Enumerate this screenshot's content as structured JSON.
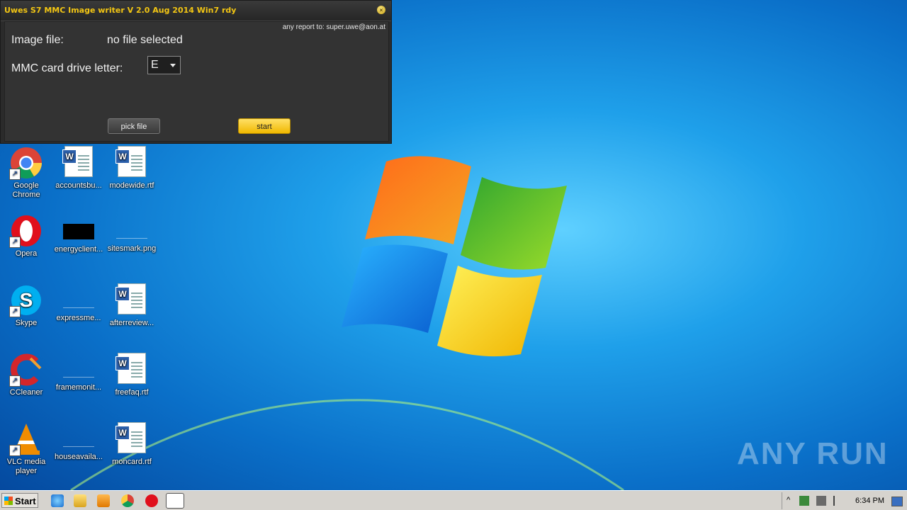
{
  "app": {
    "title": "Uwes S7 MMC Image writer V 2.0  Aug 2014 Win7 rdy",
    "report": "any report to: super.uwe@aon.at",
    "image_file_label": "Image file:",
    "image_file_value": "no file selected",
    "drive_label": "MMC card drive letter:",
    "drive_value": "E",
    "pick_label": "pick file",
    "start_label": "start"
  },
  "desktop": {
    "icons": [
      {
        "label": "Google Chrome",
        "icon": "chrome-icon"
      },
      {
        "label": "accountsbu...",
        "icon": "word-doc-icon"
      },
      {
        "label": "modewide.rtf",
        "icon": "word-doc-icon"
      },
      {
        "label": "Opera",
        "icon": "opera-icon"
      },
      {
        "label": "energyclient...",
        "icon": "image-icon"
      },
      {
        "label": "sitesmark.png",
        "icon": "image-icon"
      },
      {
        "label": "Skype",
        "icon": "skype-icon"
      },
      {
        "label": "expressme...",
        "icon": "file-icon"
      },
      {
        "label": "afterreview...",
        "icon": "word-doc-icon"
      },
      {
        "label": "CCleaner",
        "icon": "ccleaner-icon"
      },
      {
        "label": "framemonit...",
        "icon": "file-icon"
      },
      {
        "label": "freefaq.rtf",
        "icon": "word-doc-icon"
      },
      {
        "label": "VLC media player",
        "icon": "vlc-icon"
      },
      {
        "label": "houseavaila...",
        "icon": "file-icon"
      },
      {
        "label": "moncard.rtf",
        "icon": "word-doc-icon"
      }
    ]
  },
  "taskbar": {
    "start_label": "Start",
    "clock": "6:34 PM"
  },
  "watermark": "ANY RUN"
}
